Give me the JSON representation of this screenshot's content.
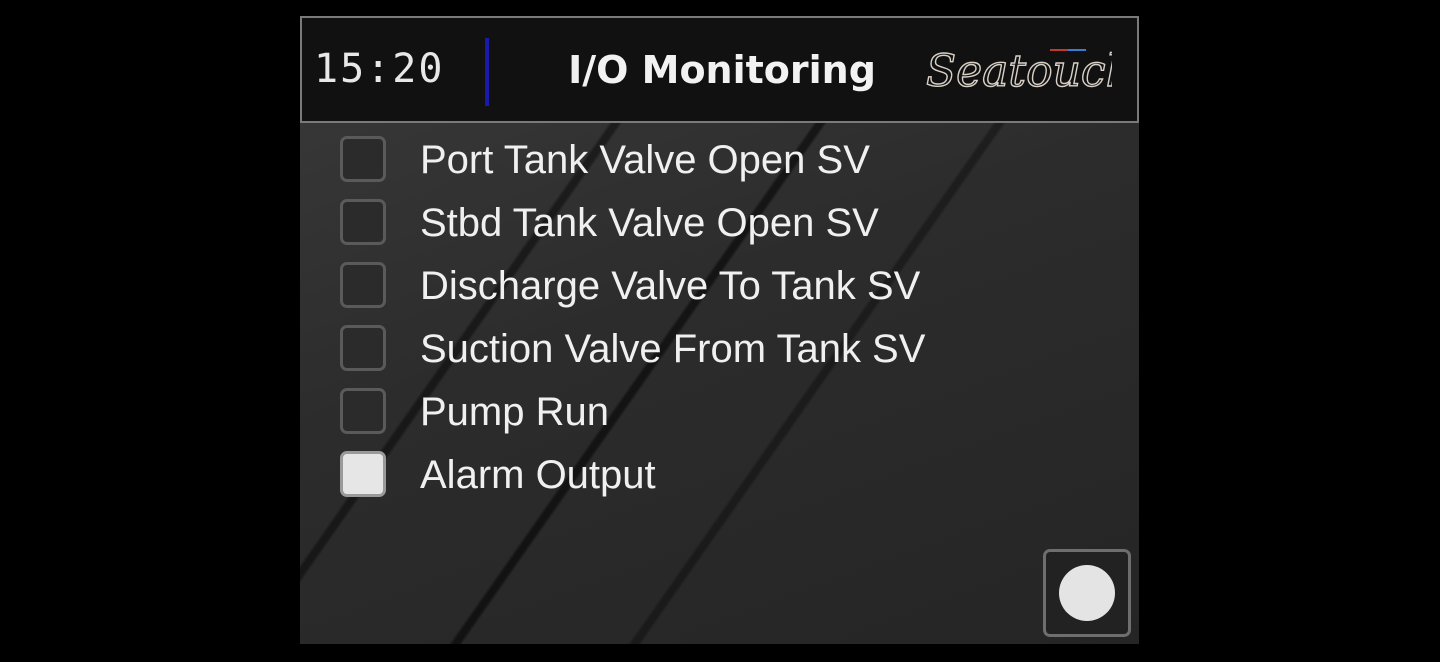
{
  "header": {
    "time": "15:20",
    "title": "I/O Monitoring",
    "logo_text": "Seatouch",
    "divider_color": "#1a1aa8"
  },
  "io_list": [
    {
      "label": "Port Tank Valve Open SV",
      "active": false
    },
    {
      "label": "Stbd Tank Valve Open SV",
      "active": false
    },
    {
      "label": "Discharge Valve To Tank SV",
      "active": false
    },
    {
      "label": "Suction Valve From Tank SV",
      "active": false
    },
    {
      "label": "Pump Run",
      "active": false
    },
    {
      "label": "Alarm Output",
      "active": true
    }
  ],
  "home_button": {
    "icon": "circle-home-icon"
  },
  "colors": {
    "indicator_on": "#e6e6e6",
    "indicator_off": "#2b2b2b"
  }
}
